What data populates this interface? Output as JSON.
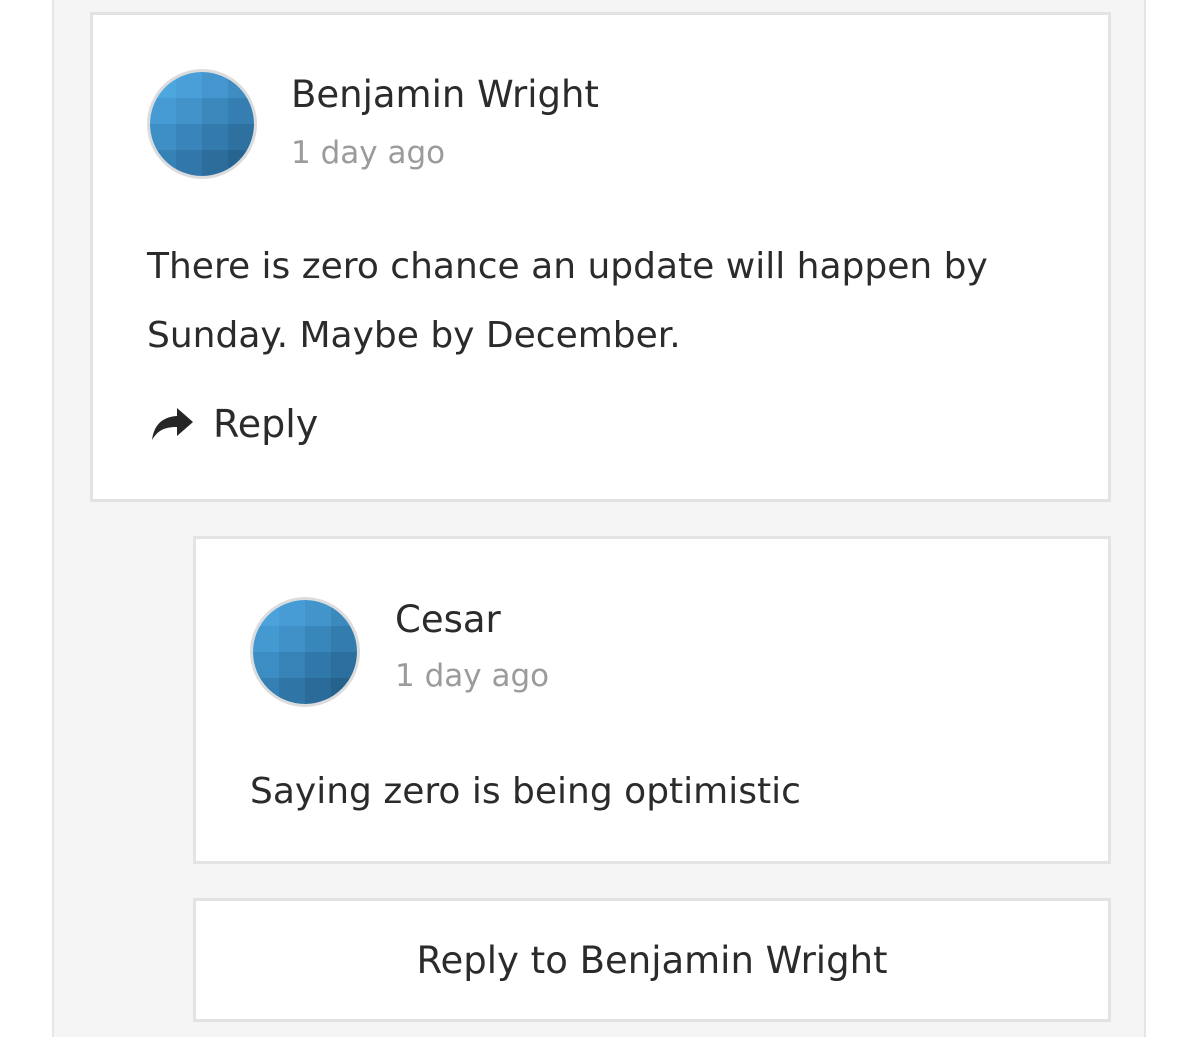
{
  "colors": {
    "avatar_light": "#4a9fd8",
    "avatar_dark": "#2f6a95",
    "card_border": "#e3e3e3",
    "background": "#f5f5f5",
    "timestamp": "#9b9b9b",
    "text": "#2b2b2b"
  },
  "comment": {
    "author": "Benjamin Wright",
    "timestamp": "1 day ago",
    "body": "There is zero chance an update will happen by Sunday. Maybe by December.",
    "reply_icon": "share-arrow-icon",
    "reply_label": "Reply"
  },
  "reply": {
    "author": "Cesar",
    "timestamp": "1 day ago",
    "body": "Saying zero is being optimistic"
  },
  "reply_to_button": {
    "label": "Reply to Benjamin Wright"
  }
}
